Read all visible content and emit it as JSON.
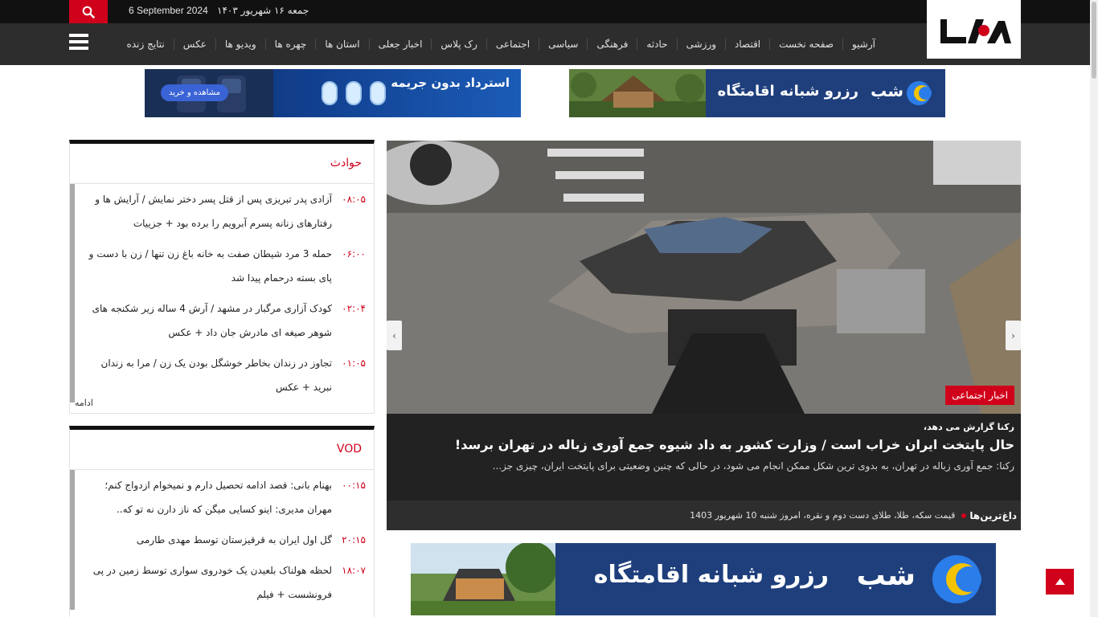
{
  "topbar": {
    "date_en": "6 September 2024",
    "date_fa": "جمعه ۱۶ شهریور ۱۴۰۳",
    "search_icon": "search-icon"
  },
  "logo": {
    "text": "رکنا"
  },
  "nav": {
    "items": [
      "آرشیو",
      "صفحه نخست",
      "اقتصاد",
      "ورزشی",
      "حادثه",
      "فرهنگی",
      "سیاسی",
      "اجتماعی",
      "رک پلاس",
      "اخبار جعلی",
      "استان ها",
      "چهره ها",
      "ویدیو ها",
      "عکس",
      "نتایج زنده"
    ]
  },
  "ads": {
    "top_left_text": "استرداد بدون جریمه",
    "top_left_button": "مشاهده و خرید",
    "top_right_brand": "شب",
    "top_right_text": "رزرو شبانه اقامتگاه",
    "bottom_brand": "شب",
    "bottom_text": "رزرو شبانه اقامتگاه"
  },
  "slider": {
    "category": "اخبار اجتماعی",
    "lead": "رکنا گزارش می دهد،",
    "headline": "حال پایتخت ایران خراب است / وزارت کشور به داد شیوه جمع آوری زباله در تهران برسد!",
    "summary": "رکنا: جمع آوری زباله در تهران، به بدوی ترین شکل ممکن انجام می شود، در حالی که چنین وضعیتی برای پایتخت ایران، چیزی جز...",
    "ticker_label": "داغ‌ترین‌ها",
    "ticker_text": "قیمت سکه، طلا، طلای دست دوم و نقره، امروز شنبه 10 شهریور 1403"
  },
  "box_accidents": {
    "title": "حوادث",
    "more": "ادامه",
    "items": [
      {
        "time": "۰۸:۰۵",
        "text": "آزادی پدر تبریزی پس از قتل پسر دختر نمایش / آرایش ها و رفتارهای زنانه پسرم آبرویم را برده بود + جزییات"
      },
      {
        "time": "۰۶:۰۰",
        "text": "حمله 3 مرد شیطان صفت به خانه باغ زن تنها / زن با دست و پای بسته درحمام پیدا شد"
      },
      {
        "time": "۰۲:۰۴",
        "text": "کودک آزاری مرگبار در مشهد / آرش 4 ساله زیر شکنجه های شوهر صیغه ای مادرش جان داد + عکس"
      },
      {
        "time": "۰۱:۰۵",
        "text": "تجاوز در زندان بخاطر خوشگل بودن یک زن / مرا به زندان نبرید + عکس"
      }
    ]
  },
  "box_vod": {
    "title": "VOD",
    "items": [
      {
        "time": "۰۰:۱۵",
        "text": "بهنام بانی: قصد ادامه تحصیل دارم و نمیخوام ازدواج کنم؛ مهران مدیری: اینو کسایی میگن که ناز دارن نه تو که.."
      },
      {
        "time": "۲۰:۱۵",
        "text": "گل اول ایران به قرقیزستان توسط مهدی طارمی"
      },
      {
        "time": "۱۸:۰۷",
        "text": "لحظه هولناک بلعیدن یک خودروی سواری توسط زمین در پی فرونشست + فیلم"
      }
    ]
  },
  "colors": {
    "accent": "#d0021b",
    "topbar": "#111111",
    "navbar": "#2d2d2d"
  }
}
